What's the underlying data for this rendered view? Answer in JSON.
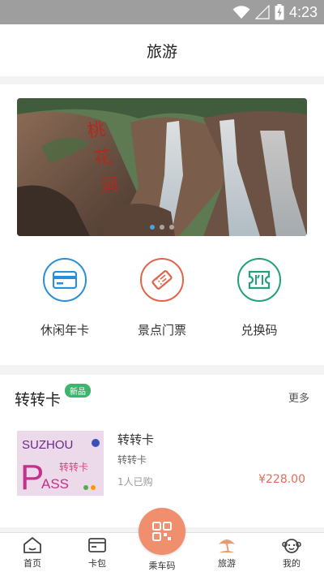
{
  "status_bar": {
    "time": "4:23",
    "icons": [
      "wifi-icon",
      "signal-icon",
      "battery-icon"
    ]
  },
  "header": {
    "title": "旅游"
  },
  "banner": {
    "image": "waterfall-scenery-photo",
    "carved_text": "桃花涧",
    "slides": 3,
    "active_slide": 1
  },
  "shortcuts": [
    {
      "label": "休闲年卡",
      "icon": "card-icon",
      "color": "#2b8fd6"
    },
    {
      "label": "景点门票",
      "icon": "ticket-icon",
      "color": "#e0644a"
    },
    {
      "label": "兑换码",
      "icon": "redeem-code-icon",
      "color": "#21a07d"
    }
  ],
  "zhuanzhuan": {
    "title": "转转卡",
    "badge": "新品",
    "more": "更多",
    "product": {
      "thumb_text_top": "SUZHOU",
      "thumb_text_bottom": "ASS",
      "thumb_letter": "P",
      "thumb_brand": "转转卡",
      "name": "转转卡",
      "subtitle": "转转卡",
      "sold": "1人已购",
      "price": "¥228.00"
    }
  },
  "tabbar": {
    "items": [
      {
        "label": "首页",
        "icon": "home-icon"
      },
      {
        "label": "卡包",
        "icon": "wallet-icon"
      },
      {
        "label": "乘车码",
        "icon": "qr-code-icon"
      },
      {
        "label": "旅游",
        "icon": "beach-umbrella-icon",
        "active": true
      },
      {
        "label": "我的",
        "icon": "monkey-face-icon"
      }
    ],
    "active_color": "#e89b72"
  }
}
